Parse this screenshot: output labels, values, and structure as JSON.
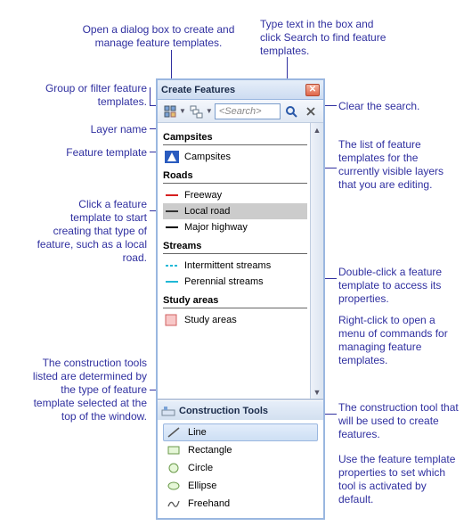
{
  "annotations": {
    "open_dialog": "Open a dialog box to create and manage feature templates.",
    "type_search": "Type text in the box and click Search to find feature templates.",
    "group_filter": "Group or filter feature templates.",
    "layer_name": "Layer name",
    "feature_template": "Feature template",
    "click_template": "Click a feature template to start creating that type of feature, such as a local road.",
    "tools_determined": "The construction tools listed are determined by the type of feature template selected at the top of the window.",
    "clear_search": "Clear the search.",
    "list_desc": "The list of feature templates for the currently visible layers that you are editing.",
    "dblclick": "Double-click a feature template to access its properties.",
    "rightclick": "Right-click to open a menu of commands for managing feature templates.",
    "tool_used": "The construction tool that will be used to create features.",
    "set_default": "Use the feature template properties to set which tool is activated by default."
  },
  "panel": {
    "title": "Create Features",
    "search_placeholder": "<Search>",
    "layers": [
      {
        "name": "Campsites",
        "items": [
          {
            "label": "Campsites",
            "sym": "camp"
          }
        ]
      },
      {
        "name": "Roads",
        "items": [
          {
            "label": "Freeway",
            "sym": "line-red"
          },
          {
            "label": "Local road",
            "sym": "line-black",
            "selected": true
          },
          {
            "label": "Major highway",
            "sym": "line-black"
          }
        ]
      },
      {
        "name": "Streams",
        "items": [
          {
            "label": "Intermittent streams",
            "sym": "line-cyan-dash"
          },
          {
            "label": "Perennial streams",
            "sym": "line-cyan"
          }
        ]
      },
      {
        "name": "Study areas",
        "items": [
          {
            "label": "Study areas",
            "sym": "poly-pink"
          }
        ]
      }
    ],
    "tools_title": "Construction Tools",
    "tools": [
      {
        "label": "Line",
        "icon": "line",
        "selected": true
      },
      {
        "label": "Rectangle",
        "icon": "rect"
      },
      {
        "label": "Circle",
        "icon": "circle"
      },
      {
        "label": "Ellipse",
        "icon": "ellipse"
      },
      {
        "label": "Freehand",
        "icon": "freehand"
      }
    ]
  }
}
